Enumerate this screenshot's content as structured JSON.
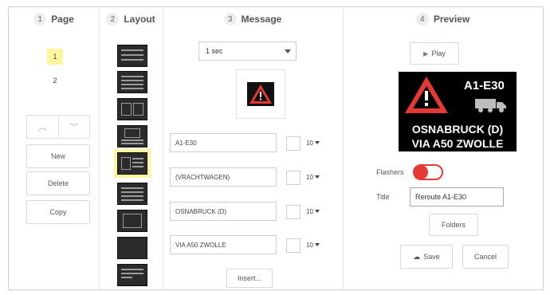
{
  "columns": {
    "page": {
      "num": "1",
      "title": "Page"
    },
    "layout": {
      "num": "2",
      "title": "Layout"
    },
    "message": {
      "num": "3",
      "title": "Message"
    },
    "preview": {
      "num": "4",
      "title": "Preview"
    }
  },
  "pages": [
    "1",
    "2"
  ],
  "page_buttons": {
    "new": "New",
    "delete": "Delete",
    "copy": "Copy"
  },
  "message": {
    "duration": "1 sec",
    "lines": [
      {
        "text": "A1-E30",
        "size": "10"
      },
      {
        "text": "(VRACHTWAGEN)",
        "size": "10"
      },
      {
        "text": "OSNABRUCK (D)",
        "size": "10"
      },
      {
        "text": "VIA A50 ZWOLLE",
        "size": "10"
      }
    ],
    "insert_label": "Insert..."
  },
  "preview": {
    "play_label": "Play",
    "sign_line1": "A1-E30",
    "sign_line3": "OSNABRUCK (D)",
    "sign_line4": "VIA A50 ZWOLLE",
    "flashers_label": "Flashers",
    "flashers_on": true,
    "title_label": "Title",
    "title_value": "Reroute A1-E30",
    "folders_label": "Folders",
    "save_label": "Save",
    "cancel_label": "Cancel"
  },
  "colors": {
    "accent": "#e53935",
    "highlight": "#fff59d",
    "sign_bg": "#000000"
  }
}
